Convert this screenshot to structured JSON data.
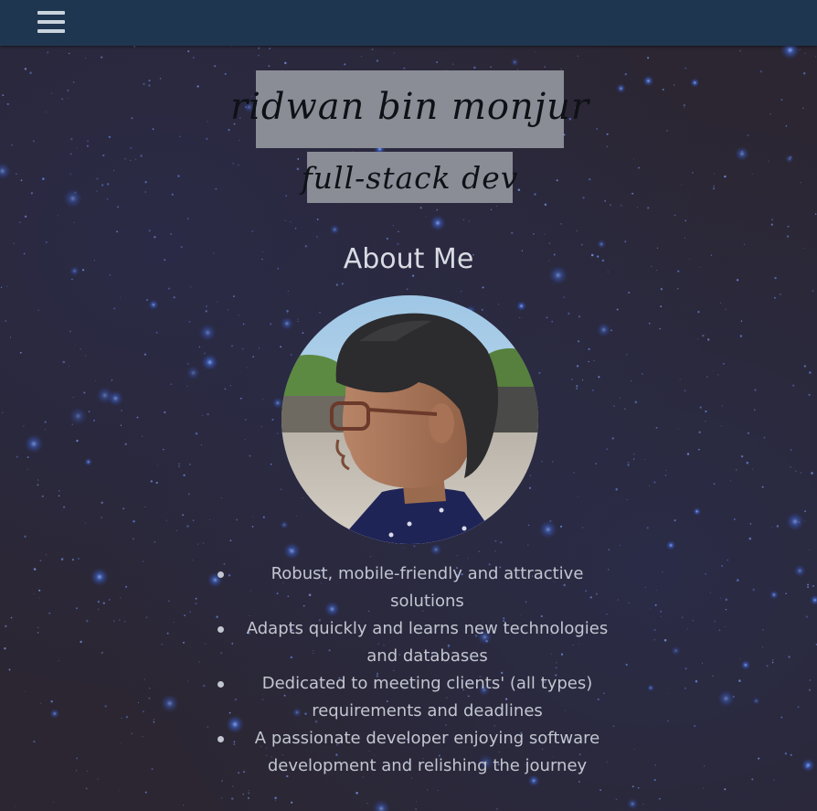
{
  "header": {
    "menu_icon": "hamburger-menu-icon",
    "bar_color": "#1f3650"
  },
  "hero": {
    "name": "ridwan bin monjur",
    "role": "full-stack dev"
  },
  "about": {
    "title": "About Me",
    "avatar_icon": "profile-photo",
    "features": [
      "Robust, mobile-friendly and attractive solutions",
      "Adapts quickly and learns new technologies and databases",
      "Dedicated to meeting clients' (all types) requirements and deadlines",
      "A passionate developer enjoying software development and relishing the journey"
    ]
  },
  "colors": {
    "background": "#2b2631",
    "star": "#5a7ad6",
    "label_box": "#8a8d96",
    "text": "#c2c6d0"
  }
}
